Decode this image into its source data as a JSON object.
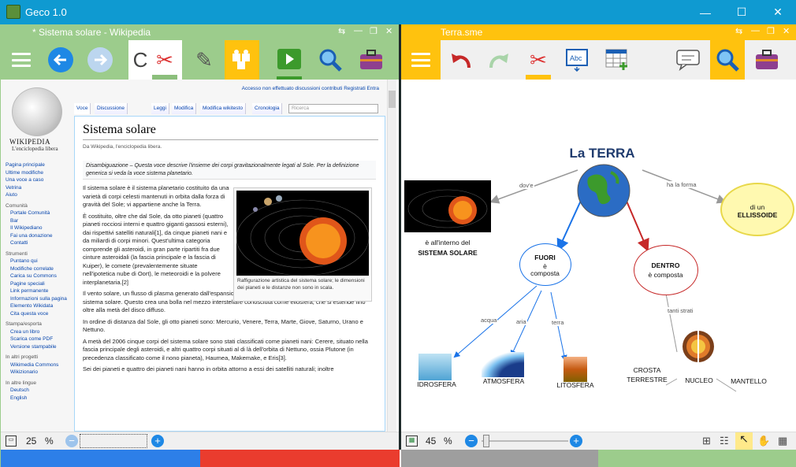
{
  "window": {
    "title": "Geco 1.0",
    "controls": [
      "—",
      "☐",
      "✕"
    ]
  },
  "left": {
    "tab_title": "*  Sistema solare - Wikipedia",
    "zoom": "25",
    "zoom_unit": "%",
    "wiki": {
      "logo_name": "WIKIPEDIA",
      "logo_tagline": "L'enciclopedia libera",
      "top_links": "Accesso non effettuato   discussioni   contributi   Registrati   Entra",
      "tabs": [
        "Voce",
        "Discussione",
        "Leggi",
        "Modifica",
        "Modifica wikitesto",
        "Cronologia"
      ],
      "search_placeholder": "Ricerca",
      "nav1": [
        "Pagina principale",
        "Ultime modifiche",
        "Una voce a caso",
        "Vetrina",
        "Aiuto"
      ],
      "nav_comunita_h": "Comunità",
      "nav_comunita": [
        "Portale Comunità",
        "Bar",
        "Il Wikipediano",
        "Fai una donazione",
        "Contatti"
      ],
      "nav_strumenti_h": "Strumenti",
      "nav_strumenti": [
        "Puntano qui",
        "Modifiche correlate",
        "Carica su Commons",
        "Pagine speciali",
        "Link permanente",
        "Informazioni sulla pagina",
        "Elemento Wikidata",
        "Cita questa voce"
      ],
      "nav_stampa_h": "Stampa/esporta",
      "nav_stampa": [
        "Crea un libro",
        "Scarica come PDF",
        "Versione stampabile"
      ],
      "nav_progetti_h": "In altri progetti",
      "nav_progetti": [
        "Wikimedia Commons",
        "Wikizionario"
      ],
      "nav_lingue_h": "In altre lingue",
      "nav_lingue": [
        "Deutsch",
        "English"
      ],
      "heading": "Sistema solare",
      "subtitle": "Da Wikipedia, l'enciclopedia libera.",
      "disambig": "Disambiguazione – Questa voce descrive l'insieme dei corpi gravitazionalmente legati al Sole. Per la definizione generica si veda la voce sistema planetario.",
      "p1": "Il sistema solare è il sistema planetario costituito da una varietà di corpi celesti mantenuti in orbita dalla forza di gravità del Sole; vi appartiene anche la Terra.",
      "p2": "È costituito, oltre che dal Sole, da otto pianeti (quattro pianeti rocciosi interni e quattro giganti gassosi esterni), dai rispettivi satelliti naturali[1], da cinque pianeti nani e da miliardi di corpi minori. Quest'ultima categoria comprende gli asteroidi, in gran parte ripartiti fra due cinture asteroidali (la fascia principale e la fascia di Kuiper), le comete (prevalentemente situate nell'ipotetica nube di Oort), le meteoroidi e la polvere interplanetaria.[2]",
      "p3": "Il vento solare, un flusso di plasma generato dall'espansione continua della corona solare, permea l'intero sistema solare. Questo crea una bolla nel mezzo interstellare conosciuta come eliosfera, che si estende fino oltre alla metà del disco diffuso.",
      "p4": "In ordine di distanza dal Sole, gli otto pianeti sono: Mercurio, Venere, Terra, Marte, Giove, Saturno, Urano e Nettuno.",
      "p5": "A metà del 2006 cinque corpi del sistema solare sono stati classificati come pianeti nani: Cerere, situato nella fascia principale degli asteroidi, e altri quattro corpi situati al di là dell'orbita di Nettuno, ossia Plutone (in precedenza classificato come il nono pianeta), Haumea, Makemake, e Eris[3].",
      "p6": "Sei dei pianeti e quattro dei pianeti nani hanno in orbita attorno a essi dei satelliti naturali; inoltre",
      "caption": "Raffigurazione artistica del sistema solare; le dimensioni dei pianeti e le distanze non sono in scala."
    }
  },
  "right": {
    "tab_title": "Terra.sme",
    "zoom": "45",
    "zoom_unit": "%",
    "map": {
      "title": "La TERRA",
      "link_dove": "dov'e",
      "link_forma": "ha la forma",
      "solar_line1": "è all'interno del",
      "solar_line2": "SISTEMA SOLARE",
      "ellisse_line1": "di un",
      "ellisse_line2": "ELLISSOIDE",
      "fuori_line1": "FUORI",
      "fuori_line2": "è",
      "fuori_line3": "composta",
      "dentro_line1": "DENTRO",
      "dentro_line2": "è composta",
      "link_acqua": "acqua",
      "link_aria": "aria",
      "link_terra": "terra",
      "link_strati": "tanti strati",
      "idrosfera": "IDROSFERA",
      "atmosfera": "ATMOSFERA",
      "litosfera": "LITOSFERA",
      "crosta_line1": "CROSTA",
      "crosta_line2": "TERRESTRE",
      "nucleo": "NUCLEO",
      "mantello": "MANTELLO"
    }
  },
  "colors": {
    "left_accent": "#9ccc8c",
    "right_accent": "#ffc20e",
    "title_blue": "#0f9ad1"
  }
}
